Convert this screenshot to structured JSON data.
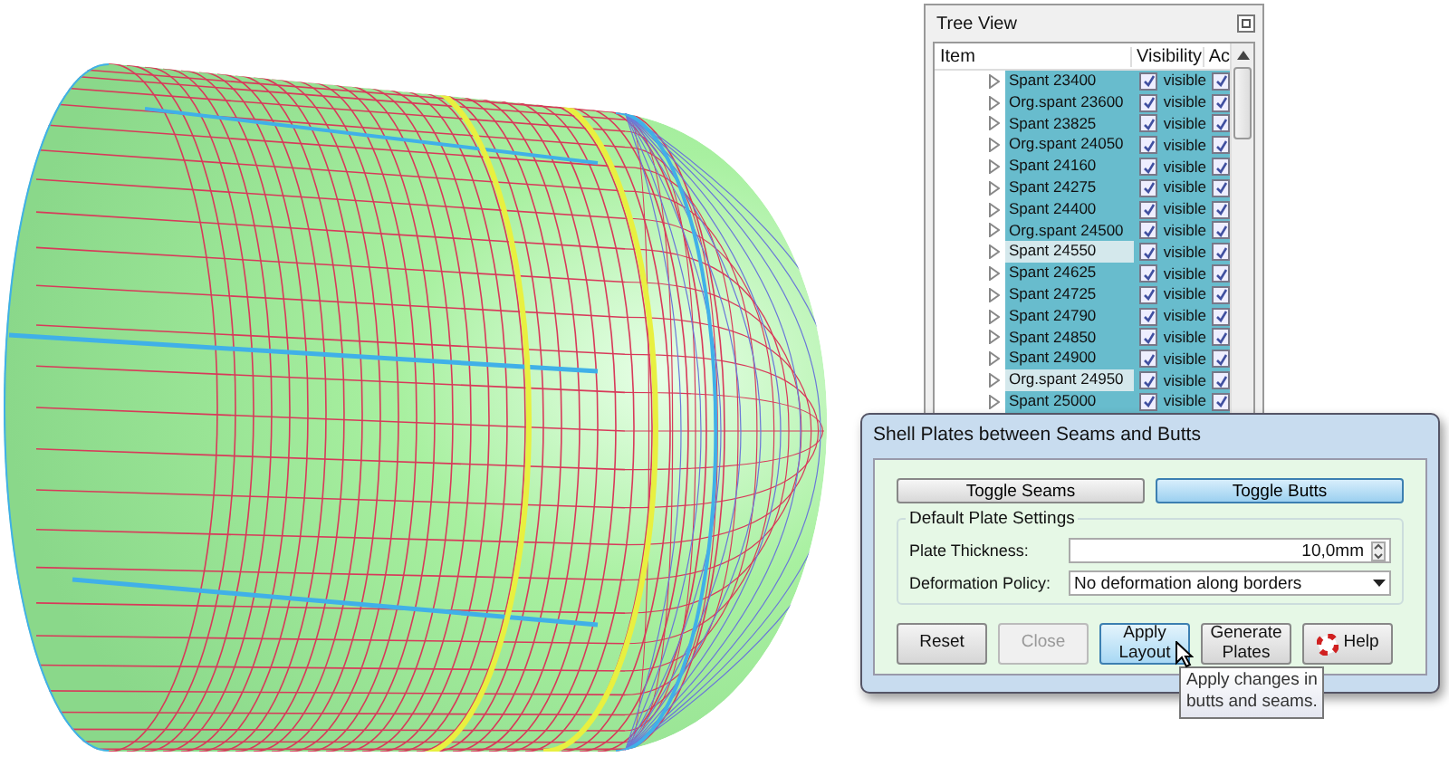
{
  "tree_view": {
    "title": "Tree View",
    "columns": [
      "Item",
      "Visibility",
      "Ac"
    ],
    "rows": [
      {
        "item": "Spant  23400",
        "selected": false,
        "visibility_checked": true,
        "visibility": "visible",
        "column_3_checked": true
      },
      {
        "item": "Org.spant 23600",
        "selected": false,
        "visibility_checked": true,
        "visibility": "visible",
        "column_3_checked": true
      },
      {
        "item": "Spant  23825",
        "selected": false,
        "visibility_checked": true,
        "visibility": "visible",
        "column_3_checked": true
      },
      {
        "item": "Org.spant 24050",
        "selected": false,
        "visibility_checked": true,
        "visibility": "visible",
        "column_3_checked": true
      },
      {
        "item": "Spant  24160",
        "selected": false,
        "visibility_checked": true,
        "visibility": "visible",
        "column_3_checked": true
      },
      {
        "item": "Spant  24275",
        "selected": false,
        "visibility_checked": true,
        "visibility": "visible",
        "column_3_checked": true
      },
      {
        "item": "Spant  24400",
        "selected": false,
        "visibility_checked": true,
        "visibility": "visible",
        "column_3_checked": true
      },
      {
        "item": "Org.spant 24500",
        "selected": false,
        "visibility_checked": true,
        "visibility": "visible",
        "column_3_checked": true
      },
      {
        "item": "Spant  24550",
        "selected": true,
        "visibility_checked": true,
        "visibility": "visible",
        "column_3_checked": true
      },
      {
        "item": "Spant  24625",
        "selected": false,
        "visibility_checked": true,
        "visibility": "visible",
        "column_3_checked": true
      },
      {
        "item": "Spant  24725",
        "selected": false,
        "visibility_checked": true,
        "visibility": "visible",
        "column_3_checked": true
      },
      {
        "item": "Spant  24790",
        "selected": false,
        "visibility_checked": true,
        "visibility": "visible",
        "column_3_checked": true
      },
      {
        "item": "Spant  24850",
        "selected": false,
        "visibility_checked": true,
        "visibility": "visible",
        "column_3_checked": true
      },
      {
        "item": "Spant  24900",
        "selected": false,
        "visibility_checked": true,
        "visibility": "visible",
        "column_3_checked": true
      },
      {
        "item": "Org.spant 24950",
        "selected": true,
        "visibility_checked": true,
        "visibility": "visible",
        "column_3_checked": true
      },
      {
        "item": "Spant  25000",
        "selected": false,
        "visibility_checked": true,
        "visibility": "visible",
        "column_3_checked": true
      }
    ]
  },
  "dialog": {
    "title": "Shell Plates between Seams and Butts",
    "toggles": [
      {
        "label": "Toggle Seams",
        "selected": false
      },
      {
        "label": "Toggle Butts",
        "selected": true
      }
    ],
    "group_title": "Default Plate Settings",
    "plate_thickness": {
      "label": "Plate Thickness:",
      "value": "10,0mm"
    },
    "deformation_policy": {
      "label": "Deformation Policy:",
      "value": "No deformation along borders"
    },
    "buttons": [
      {
        "label": "Reset",
        "kind": "plain",
        "disabled": false,
        "hovered": false
      },
      {
        "label": "Close",
        "kind": "plain",
        "disabled": true,
        "hovered": false
      },
      {
        "label": "Apply\nLayout",
        "kind": "plain",
        "disabled": false,
        "hovered": true
      },
      {
        "label": "Generate\nPlates",
        "kind": "plain",
        "disabled": false,
        "hovered": false
      },
      {
        "label": "Help",
        "kind": "help",
        "disabled": false,
        "hovered": false
      }
    ],
    "tooltip": "Apply changes in\nbutts and seams."
  }
}
